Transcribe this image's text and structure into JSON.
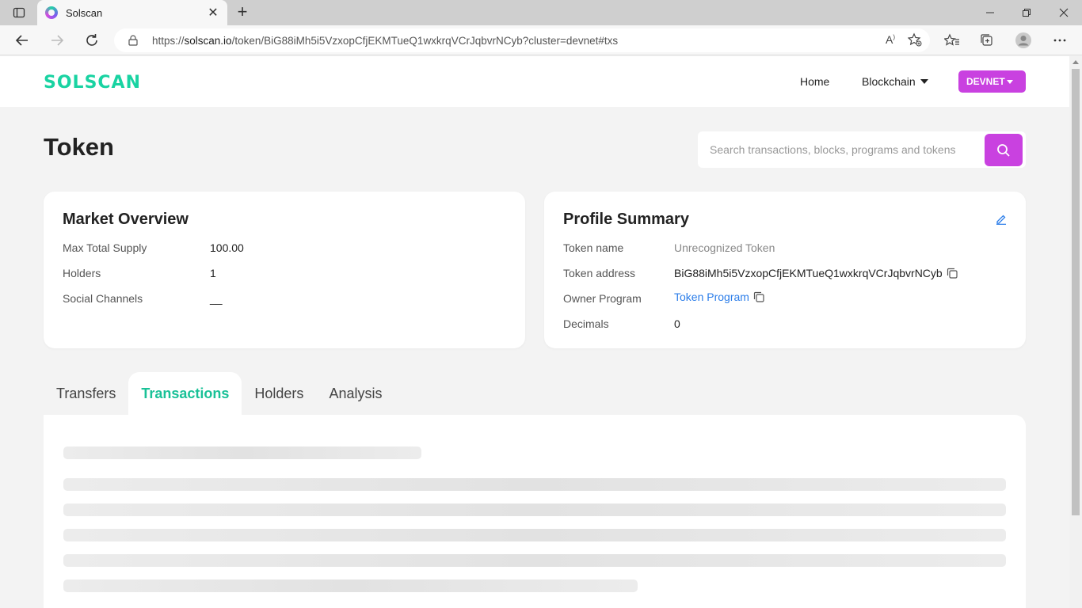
{
  "browser": {
    "tab_title": "Solscan",
    "url_prefix": "https://",
    "url_host": "solscan.io",
    "url_rest": "/token/BiG88iMh5i5VzxopCfjEKMTueQ1wxkrqVCrJqbvrNCyb?cluster=devnet#txs"
  },
  "header": {
    "logo": "SOLSCAN",
    "nav_home": "Home",
    "nav_blockchain": "Blockchain",
    "cluster_button": "DEVNET"
  },
  "page": {
    "title": "Token",
    "search_placeholder": "Search transactions, blocks, programs and tokens"
  },
  "market_overview": {
    "title": "Market Overview",
    "rows": [
      {
        "label": "Max Total Supply",
        "value": "100.00"
      },
      {
        "label": "Holders",
        "value": "1"
      },
      {
        "label": "Social Channels",
        "value": "__"
      }
    ]
  },
  "profile_summary": {
    "title": "Profile Summary",
    "rows": [
      {
        "label": "Token name",
        "value": "Unrecognized Token"
      },
      {
        "label": "Token address",
        "value": "BiG88iMh5i5VzxopCfjEKMTueQ1wxkrqVCrJqbvrNCyb"
      },
      {
        "label": "Owner Program",
        "value": "Token Program"
      },
      {
        "label": "Decimals",
        "value": "0"
      }
    ]
  },
  "tabs": [
    "Transfers",
    "Transactions",
    "Holders",
    "Analysis"
  ],
  "active_tab": "Transactions",
  "colors": {
    "brand_green": "#19d3a2",
    "accent_purple": "#c941e0",
    "link_blue": "#2b7de9"
  }
}
